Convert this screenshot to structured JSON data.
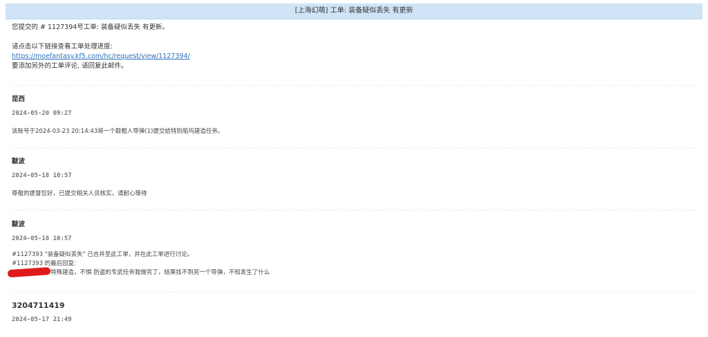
{
  "header": {
    "title": "[上海幻萌] 工单: 装备疑似丢失 有更新"
  },
  "intro": {
    "line1": "您提交的 # 1127394号工单: 装备疑似丢失 有更新。",
    "line2": "请点击以下链接查看工单处理进度:",
    "link": "https://moefantasy.kf5.com/hc/request/view/1127394/",
    "line3": "要添加另外的工单评论, 请回复此邮件。"
  },
  "entries": [
    {
      "author": "昆西",
      "time": "2024-05-20 09:27",
      "lines": [
        "该账号于2024-03-23 20:14:43将一个毂粗人导弹(1)提交给特别船坞建造任务。"
      ]
    },
    {
      "author": "黻波",
      "time": "2024-05-18 10:57",
      "lines": [
        "尊敬的提督您好，已提交相关人员核实，请耐心等待"
      ]
    },
    {
      "author": "黻波",
      "time": "2024-05-18 10:57",
      "lines": [
        "#1127393 \"装备疑似丢失\" 已合并至此工单，并在此工单进行讨论。",
        "#1127393 的最后回复:",
        "特殊建造，不惧 防盗的专武任务我做完了，结果找不到另一个导弹，不知发生了什么"
      ]
    },
    {
      "author": "3204711419",
      "time": "2024-05-17 21:49",
      "lines": []
    }
  ]
}
